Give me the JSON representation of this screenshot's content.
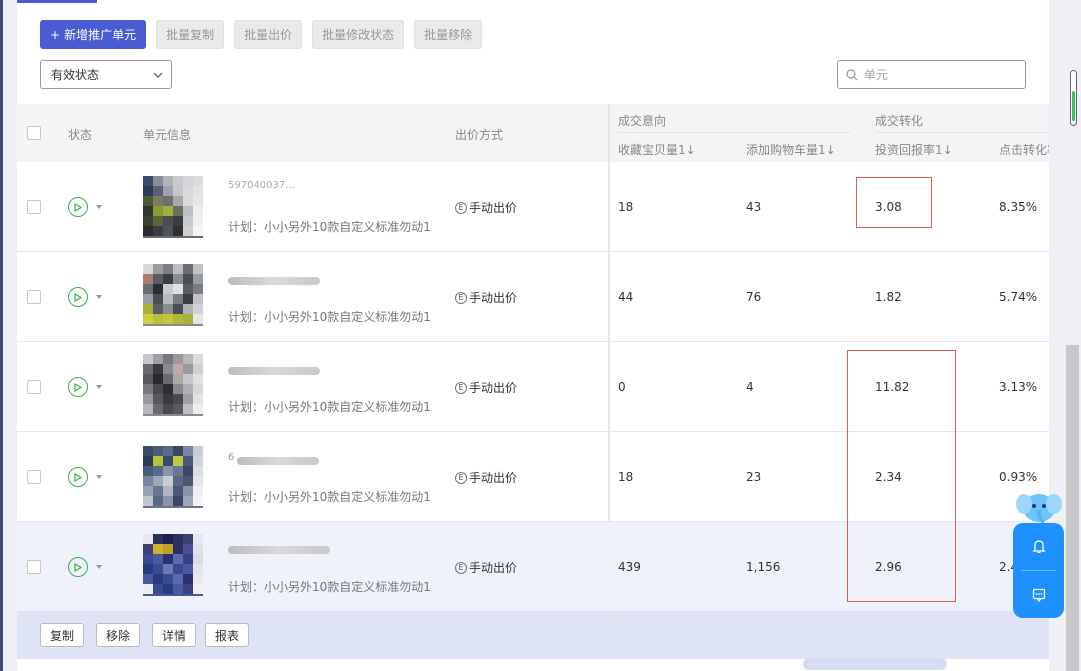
{
  "toolbar": {
    "add_label": "新增推广单元",
    "batch_copy": "批量复制",
    "batch_bid": "批量出价",
    "batch_status": "批量修改状态",
    "batch_remove": "批量移除"
  },
  "filter": {
    "status_value": "有效状态"
  },
  "search": {
    "placeholder": "单元"
  },
  "table": {
    "headers": {
      "status": "状态",
      "unit_info": "单元信息",
      "bid_method": "出价方式",
      "group_intent": "成交意向",
      "group_conversion": "成交转化",
      "col_fav": "收藏宝贝量",
      "col_cart": "添加购物车量",
      "col_roi": "投资回报率",
      "col_ctr": "点击转化率"
    },
    "rows": [
      {
        "name": "597040037...",
        "plan": "计划：小小另外10款自定义标准勿动1",
        "bid": "手动出价",
        "fav": "18",
        "cart": "43",
        "roi": "3.08",
        "ctr": "8.35%"
      },
      {
        "name": "",
        "plan": "计划：小小另外10款自定义标准勿动1",
        "bid": "手动出价",
        "fav": "44",
        "cart": "76",
        "roi": "1.82",
        "ctr": "5.74%"
      },
      {
        "name": "",
        "plan": "计划：小小另外10款自定义标准勿动1",
        "bid": "手动出价",
        "fav": "0",
        "cart": "4",
        "roi": "11.82",
        "ctr": "3.13%"
      },
      {
        "name": "6",
        "plan": "计划：小小另外10款自定义标准勿动1",
        "bid": "手动出价",
        "fav": "18",
        "cart": "23",
        "roi": "2.34",
        "ctr": "0.93%"
      },
      {
        "name": "",
        "plan": "计划：小小另外10款自定义标准勿动1",
        "bid": "手动出价",
        "fav": "439",
        "cart": "1,156",
        "roi": "2.96",
        "ctr": "2.4"
      }
    ]
  },
  "footer": {
    "copy": "复制",
    "remove": "移除",
    "detail": "详情",
    "report": "报表"
  },
  "sort_glyph": "1↓",
  "bid_glyph": "E",
  "colors": {
    "primary": "#4a5bd4",
    "success": "#36b24a",
    "float": "#1e90ff",
    "highlight_box": "#e05a5a"
  }
}
